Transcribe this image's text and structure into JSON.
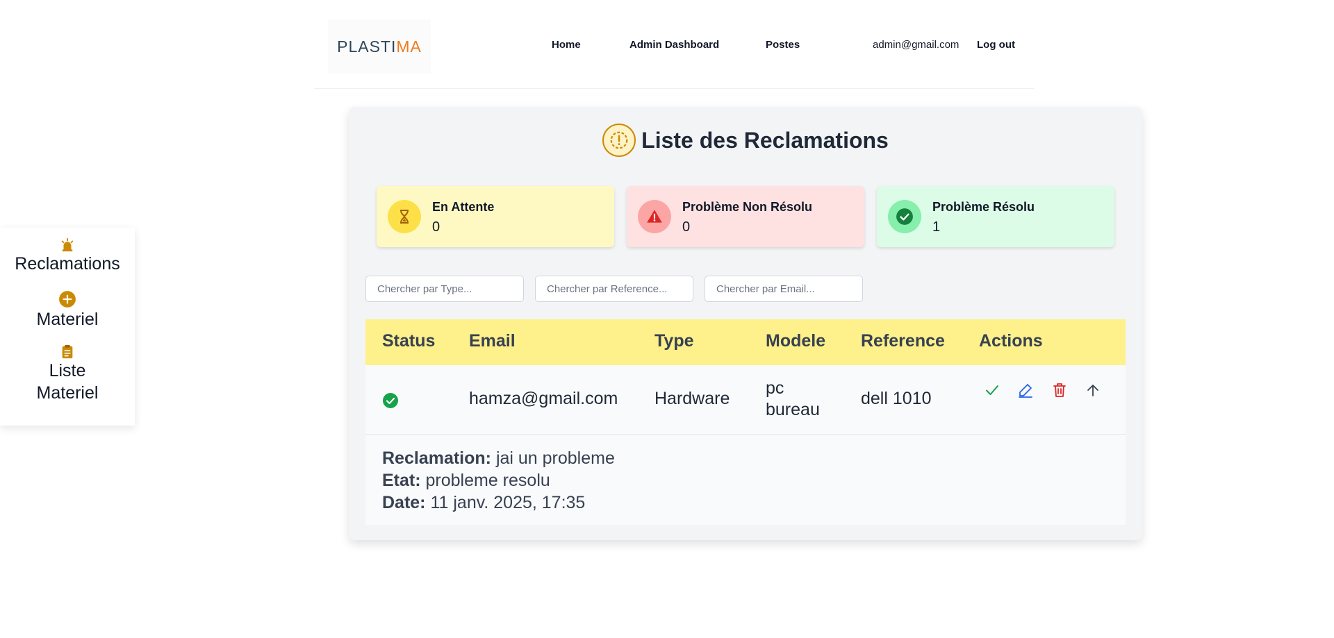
{
  "navbar": {
    "logo_part1": "PLASTI",
    "logo_part2": "MA",
    "links": {
      "home": "Home",
      "admin_dashboard": "Admin Dashboard",
      "postes": "Postes"
    },
    "user_email": "admin@gmail.com",
    "logout": "Log out"
  },
  "sidebar": {
    "items": [
      {
        "label": "Reclamations",
        "icon": "alarm-light-icon"
      },
      {
        "label": "Materiel",
        "icon": "plus-circle-icon"
      },
      {
        "label": "Liste Materiel",
        "icon": "clipboard-list-icon"
      }
    ]
  },
  "page": {
    "title": "Liste des Reclamations",
    "title_icon": "alert-circle-icon"
  },
  "stats": [
    {
      "label": "En Attente",
      "value": "0",
      "icon": "hourglass-icon",
      "bg": "#fef9c3",
      "circle": "#fde047"
    },
    {
      "label": "Problème Non Résolu",
      "value": "0",
      "icon": "warning-triangle-icon",
      "bg": "#fee2e2",
      "circle": "#fca5a5"
    },
    {
      "label": "Problème Résolu",
      "value": "1",
      "icon": "check-circle-icon",
      "bg": "#dcfce7",
      "circle": "#86efac"
    }
  ],
  "search": {
    "type_placeholder": "Chercher par Type...",
    "reference_placeholder": "Chercher par Reference...",
    "email_placeholder": "Chercher par Email..."
  },
  "table": {
    "headers": {
      "status": "Status",
      "email": "Email",
      "type": "Type",
      "modele": "Modele",
      "reference": "Reference",
      "actions": "Actions"
    },
    "rows": [
      {
        "status": "resolved",
        "email": "hamza@gmail.com",
        "type": "Hardware",
        "modele_line1": "pc",
        "modele_line2": "bureau",
        "reference": "dell 1010",
        "actions": [
          "check-icon",
          "edit-icon",
          "trash-icon",
          "arrow-up-icon"
        ],
        "detail": {
          "reclamation_label": "Reclamation:",
          "reclamation_value": "jai un probleme",
          "etat_label": "Etat:",
          "etat_value": "probleme resolu",
          "date_label": "Date:",
          "date_value": "11 janv. 2025, 17:35"
        }
      }
    ]
  },
  "colors": {
    "accent_gold": "#ca8a04",
    "header_yellow": "#fef08a",
    "success_green": "#16a34a",
    "edit_blue": "#2563eb",
    "delete_red": "#dc2626",
    "logo_dark": "#2f4659",
    "logo_orange": "#f07b1e"
  }
}
